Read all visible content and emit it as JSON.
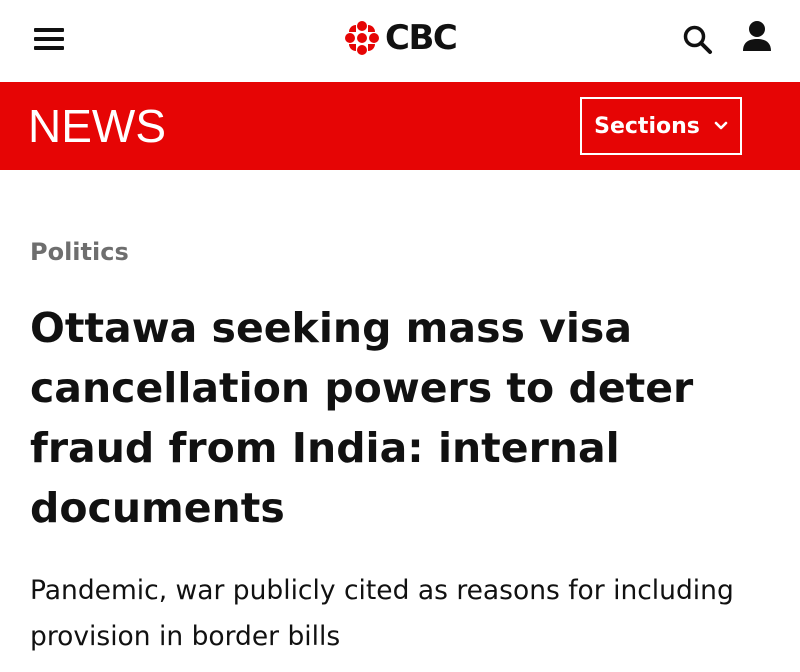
{
  "header": {
    "menu_icon": "hamburger-menu-icon",
    "brand": {
      "logo_icon": "cbc-gem-icon",
      "name": "CBC",
      "logo_color": "#e60505"
    },
    "search_icon": "search-icon",
    "account_icon": "user-account-icon"
  },
  "news_bar": {
    "title": "NEWS",
    "background_color": "#e60505",
    "sections_label": "Sections",
    "sections_icon": "chevron-down-icon"
  },
  "article": {
    "category": "Politics",
    "headline": "Ottawa seeking mass visa cancellation powers to deter fraud from India: internal documents",
    "dek": "Pandemic, war publicly cited as reasons for including provision in border bills"
  }
}
